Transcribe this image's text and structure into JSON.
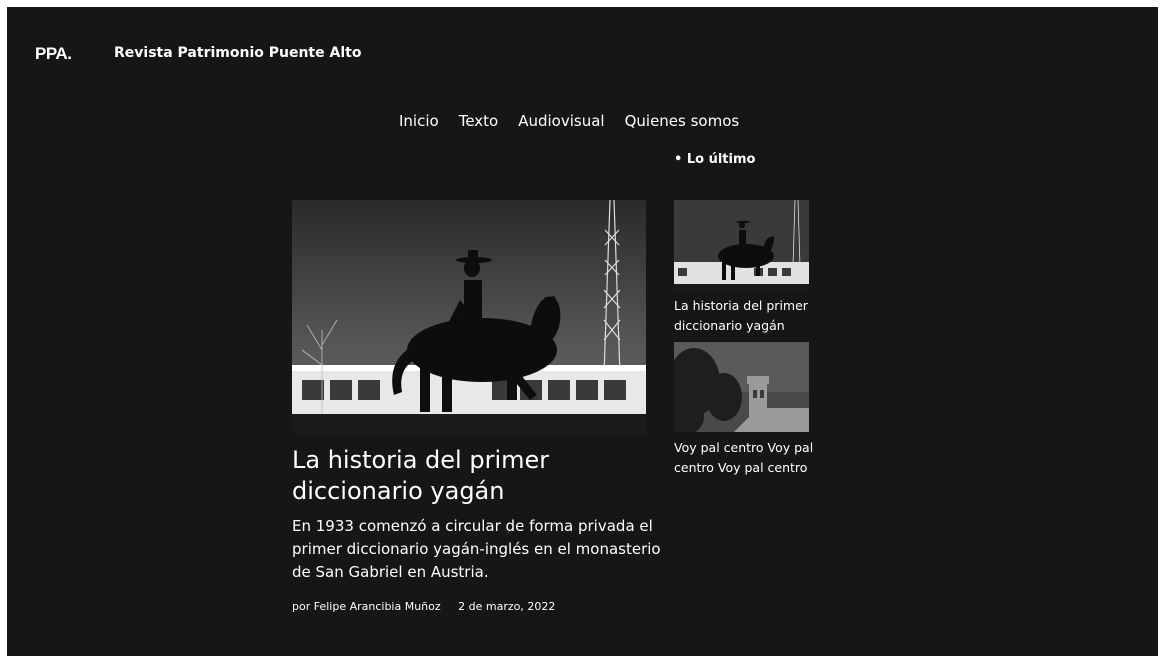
{
  "header": {
    "logo": "PPA.",
    "site_name": "Revista Patrimonio Puente Alto"
  },
  "nav": {
    "items": [
      "Inicio",
      "Texto",
      "Audiovisual",
      "Quienes somos"
    ]
  },
  "latest": {
    "label": "• Lo último",
    "items": [
      {
        "title": "La historia del primer diccionario yagán"
      },
      {
        "title": "Voy pal centro Voy pal centro Voy pal centro"
      }
    ]
  },
  "featured": {
    "title": "La historia del primer diccionario yagán",
    "excerpt": "En 1933 comenzó a circular de forma privada el primer diccionario yagán-inglés en el monasterio de San Gabriel en Austria.",
    "author": "por Felipe Arancibia Muñoz",
    "date": "2 de marzo, 2022"
  }
}
